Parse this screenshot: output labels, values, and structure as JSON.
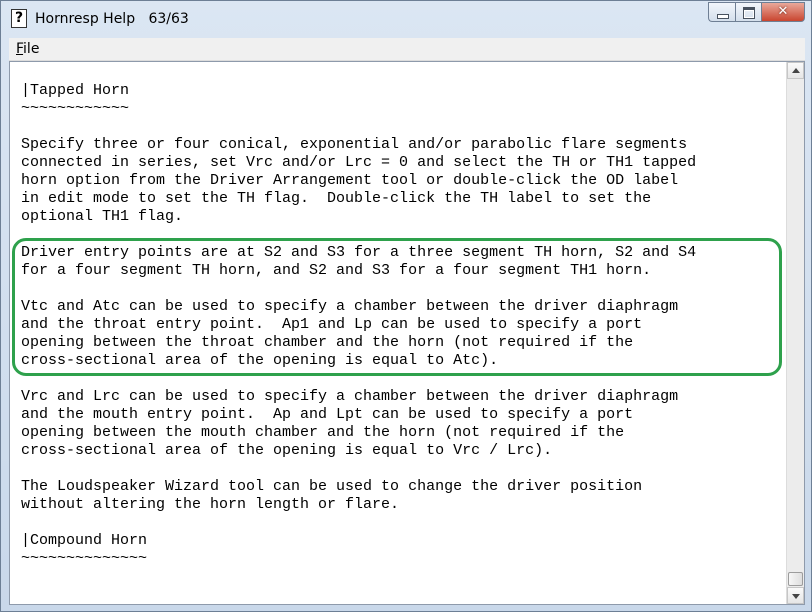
{
  "window": {
    "title": "Hornresp Help",
    "page_indicator": "63/63",
    "app_icon_glyph": "?",
    "close_glyph": "✕"
  },
  "menu": {
    "file_label_accel": "F",
    "file_label_rest": "ile"
  },
  "document": {
    "lines": [
      "|Tapped Horn",
      "~~~~~~~~~~~~",
      "",
      "Specify three or four conical, exponential and/or parabolic flare segments",
      "connected in series, set Vrc and/or Lrc = 0 and select the TH or TH1 tapped",
      "horn option from the Driver Arrangement tool or double-click the OD label",
      "in edit mode to set the TH flag.  Double-click the TH label to set the",
      "optional TH1 flag.",
      "",
      "Driver entry points are at S2 and S3 for a three segment TH horn, S2 and S4",
      "for a four segment TH horn, and S2 and S3 for a four segment TH1 horn.",
      "",
      "Vtc and Atc can be used to specify a chamber between the driver diaphragm",
      "and the throat entry point.  Ap1 and Lp can be used to specify a port",
      "opening between the throat chamber and the horn (not required if the",
      "cross-sectional area of the opening is equal to Atc).",
      "",
      "Vrc and Lrc can be used to specify a chamber between the driver diaphragm",
      "and the mouth entry point.  Ap and Lpt can be used to specify a port",
      "opening between the mouth chamber and the horn (not required if the",
      "cross-sectional area of the opening is equal to Vrc / Lrc).",
      "",
      "The Loudspeaker Wizard tool can be used to change the driver position",
      "without altering the horn length or flare.",
      "",
      "|Compound Horn",
      "~~~~~~~~~~~~~~"
    ]
  },
  "colors": {
    "highlight_border": "#2ea14c",
    "close_button": "#c9452f"
  }
}
